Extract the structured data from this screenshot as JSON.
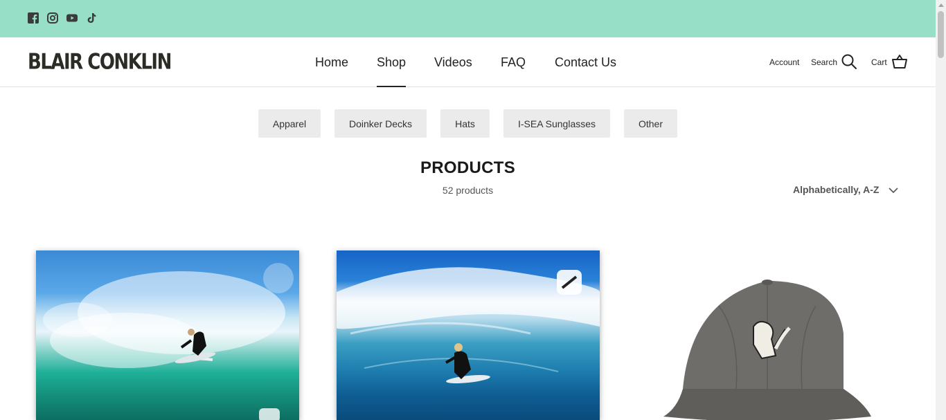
{
  "social": [
    {
      "name": "facebook-icon"
    },
    {
      "name": "instagram-icon"
    },
    {
      "name": "youtube-icon"
    },
    {
      "name": "tiktok-icon"
    }
  ],
  "brand": {
    "logo_text": "BLAIR CONKLIN"
  },
  "nav": {
    "items": [
      {
        "label": "Home"
      },
      {
        "label": "Shop",
        "active": true
      },
      {
        "label": "Videos"
      },
      {
        "label": "FAQ"
      },
      {
        "label": "Contact Us"
      }
    ]
  },
  "header_actions": {
    "account": "Account",
    "search": "Search",
    "cart": "Cart"
  },
  "categories": [
    "Apparel",
    "Doinker Decks",
    "Hats",
    "I-SEA Sunglasses",
    "Other"
  ],
  "collection": {
    "title": "PRODUCTS",
    "count": "52 products",
    "sort": "Alphabetically, A-Z"
  },
  "colors": {
    "topbar": "#98dfc7",
    "text": "#222222",
    "chip_bg": "#ebebeb"
  },
  "products": [
    {
      "image": "surfer-wave-photo-print"
    },
    {
      "image": "surfer-barrel-photo-print"
    },
    {
      "image": "grey-hat-with-logo-patch"
    }
  ]
}
